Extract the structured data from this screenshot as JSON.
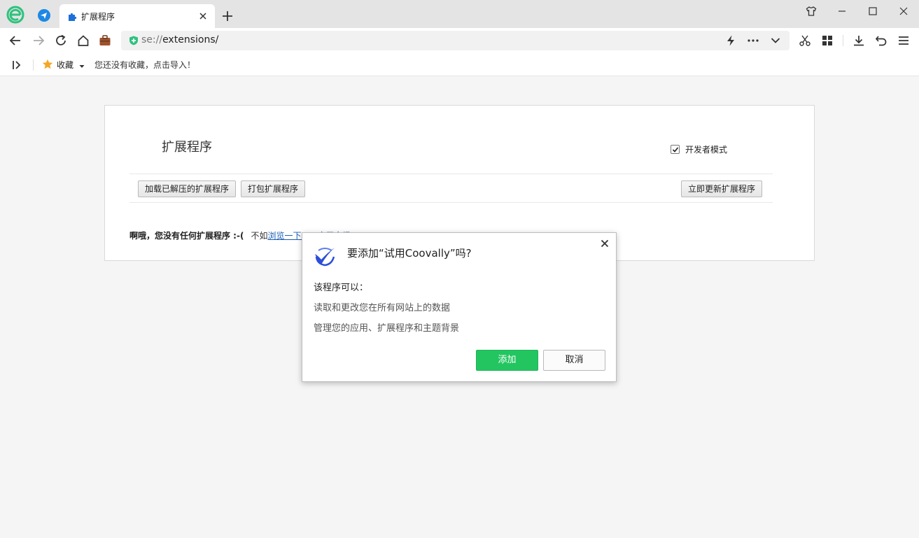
{
  "tabs": [
    {
      "title": "扩展程序",
      "icon": "puzzle-icon"
    }
  ],
  "address_bar": {
    "scheme": "se://",
    "path": "extensions/"
  },
  "bookmarks_bar": {
    "folder_label": "收藏",
    "hint": "您还没有收藏，点击导入！"
  },
  "extensions_page": {
    "title": "扩展程序",
    "developer_mode_label": "开发者模式",
    "developer_mode_checked": true,
    "load_unpacked_label": "加载已解压的扩展程序",
    "pack_label": "打包扩展程序",
    "update_now_label": "立即更新扩展程序",
    "empty_message": "啊哦，您没有任何扩展程序 :-(",
    "empty_prefix": "不如",
    "empty_link": "浏览一下360应用市场?"
  },
  "dialog": {
    "title": "要添加“试用Coovally”吗?",
    "subtitle": "该程序可以：",
    "permissions": [
      "读取和更改您在所有网站上的数据",
      "管理您的应用、扩展程序和主题背景"
    ],
    "add_label": "添加",
    "cancel_label": "取消"
  },
  "colors": {
    "accent_green": "#23c560",
    "link_blue": "#1a5fb4",
    "pinned_blue": "#1e88e5"
  }
}
